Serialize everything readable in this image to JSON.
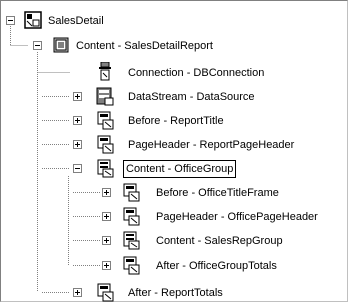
{
  "tree": {
    "nodes": [
      {
        "id": "root",
        "label": "SalesDetail",
        "icon": "report-icon",
        "state": "expanded"
      },
      {
        "id": "content-report",
        "label": "Content - SalesDetailReport",
        "icon": "group-icon",
        "state": "expanded"
      },
      {
        "id": "connection",
        "label": "Connection - DBConnection",
        "icon": "connection-icon",
        "state": "leaf"
      },
      {
        "id": "datastream",
        "label": "DataStream - DataSource",
        "icon": "datastream-icon",
        "state": "collapsed"
      },
      {
        "id": "before-title",
        "label": "Before - ReportTitle",
        "icon": "frame-icon",
        "state": "collapsed"
      },
      {
        "id": "pageheader-report",
        "label": "PageHeader - ReportPageHeader",
        "icon": "frame-icon",
        "state": "collapsed"
      },
      {
        "id": "content-office",
        "label": "Content - OfficeGroup",
        "icon": "group-icon",
        "state": "expanded",
        "selected": true
      },
      {
        "id": "before-office",
        "label": "Before - OfficeTitleFrame",
        "icon": "frame-icon",
        "state": "collapsed"
      },
      {
        "id": "pageheader-office",
        "label": "PageHeader - OfficePageHeader",
        "icon": "frame-icon",
        "state": "collapsed"
      },
      {
        "id": "content-salesrep",
        "label": "Content - SalesRepGroup",
        "icon": "group-icon",
        "state": "collapsed"
      },
      {
        "id": "after-office",
        "label": "After - OfficeGroupTotals",
        "icon": "frame-icon",
        "state": "collapsed"
      },
      {
        "id": "after-report",
        "label": "After - ReportTotals",
        "icon": "frame-icon",
        "state": "collapsed"
      }
    ]
  }
}
